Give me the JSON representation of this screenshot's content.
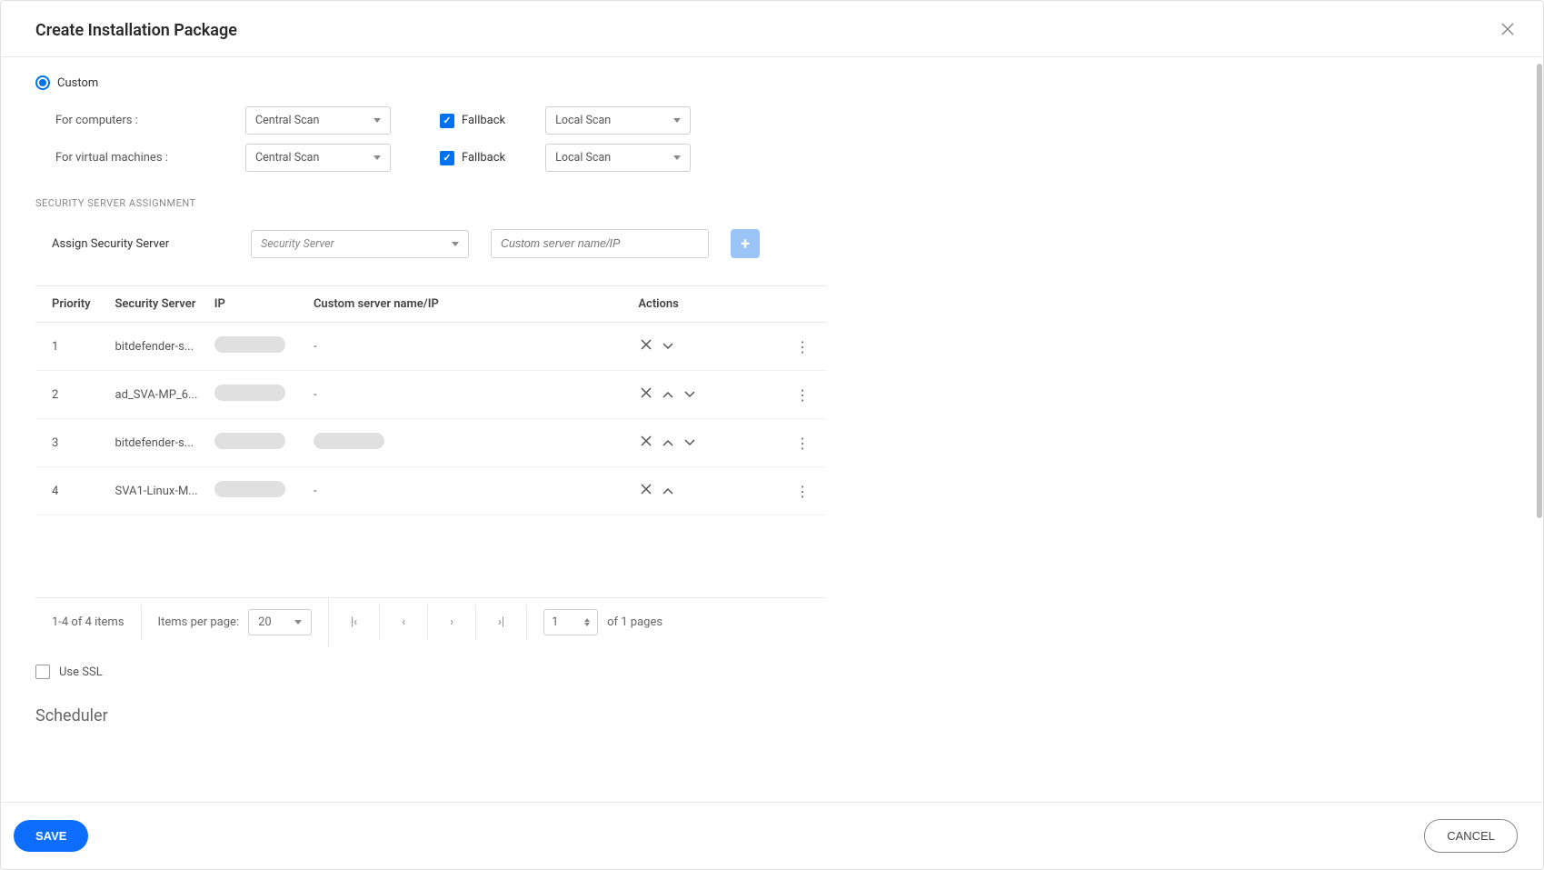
{
  "dialog": {
    "title": "Create Installation Package",
    "close_icon": "×"
  },
  "custom": {
    "label": "Custom"
  },
  "scan": {
    "computers_label": "For computers :",
    "vms_label": "For virtual machines :",
    "central_scan": "Central Scan",
    "fallback_label": "Fallback",
    "local_scan": "Local Scan"
  },
  "assignment": {
    "heading": "SECURITY SERVER ASSIGNMENT",
    "assign_label": "Assign Security Server",
    "dropdown_placeholder": "Security Server",
    "input_placeholder": "Custom server name/IP",
    "add_icon": "+"
  },
  "table": {
    "headers": {
      "priority": "Priority",
      "server": "Security Server",
      "ip": "IP",
      "custom": "Custom server name/IP",
      "actions": "Actions"
    },
    "rows": [
      {
        "priority": "1",
        "server": "bitdefender-s...",
        "custom": "-",
        "actions": [
          "close",
          "down"
        ]
      },
      {
        "priority": "2",
        "server": "ad_SVA-MP_6...",
        "custom": "-",
        "actions": [
          "close",
          "up",
          "down"
        ]
      },
      {
        "priority": "3",
        "server": "bitdefender-s...",
        "custom": "redacted",
        "actions": [
          "close",
          "up",
          "down"
        ]
      },
      {
        "priority": "4",
        "server": "SVA1-Linux-M...",
        "custom": "-",
        "actions": [
          "close",
          "up"
        ]
      }
    ]
  },
  "pagination": {
    "summary": "1-4 of 4 items",
    "ipp_label": "Items per page:",
    "ipp_value": "20",
    "first_icon": "|‹",
    "prev_icon": "‹",
    "next_icon": "›",
    "last_icon": "›|",
    "page_value": "1",
    "of_pages": "of 1 pages"
  },
  "ssl": {
    "label": "Use SSL"
  },
  "scheduler": {
    "title": "Scheduler"
  },
  "footer": {
    "save": "SAVE",
    "cancel": "CANCEL"
  }
}
